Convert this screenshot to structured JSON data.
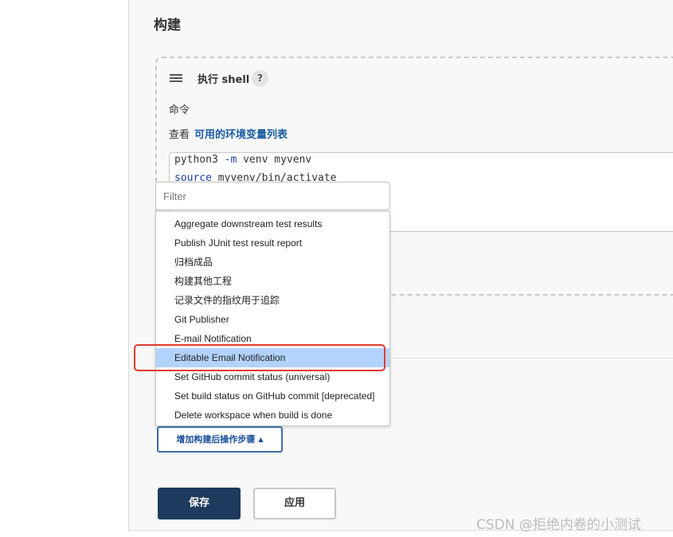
{
  "section": {
    "title": "构建"
  },
  "build_step": {
    "title": "执行 shell",
    "help_symbol": "?",
    "command_label": "命令",
    "view_prefix": "查看",
    "env_link": "可用的环境变量列表",
    "code_lines": [
      {
        "keyword": "",
        "text": "python3 ",
        "flag": "-m",
        "rest": " venv myvenv"
      },
      {
        "keyword": "source",
        "text": " myvenv/bin/activate"
      }
    ]
  },
  "filter": {
    "placeholder": "Filter",
    "value": ""
  },
  "dropdown": {
    "selected_index": 7,
    "items": [
      "Aggregate downstream test results",
      "Publish JUnit test result report",
      "归档成品",
      "构建其他工程",
      "记录文件的指纹用于追踪",
      "Git Publisher",
      "E-mail Notification",
      "Editable Email Notification",
      "Set GitHub commit status (universal)",
      "Set build status on GitHub commit [deprecated]",
      "Delete workspace when build is done"
    ]
  },
  "post_build": {
    "add_step_label": "增加构建后操作步骤",
    "caret_icon": "caret-up-icon"
  },
  "actions": {
    "save_label": "保存",
    "apply_label": "应用"
  },
  "watermark": "CSDN @拒绝内卷的小测试",
  "colors": {
    "accent": "#1e3a5c",
    "link": "#1a5ba6",
    "selection": "#b3d3ff",
    "highlight_border": "#e03a2f"
  }
}
